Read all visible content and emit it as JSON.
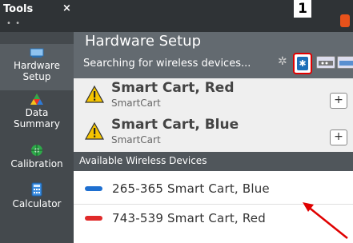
{
  "sidebar": {
    "title": "Tools",
    "close_label": "×",
    "grip": "• •",
    "items": [
      {
        "label_line1": "Hardware",
        "label_line2": "Setup",
        "icon": "hardware-icon"
      },
      {
        "label_line1": "Data",
        "label_line2": "Summary",
        "icon": "data-summary-icon"
      },
      {
        "label_line1": "Calibration",
        "label_line2": "",
        "icon": "calibration-icon"
      },
      {
        "label_line1": "Calculator",
        "label_line2": "",
        "icon": "calculator-icon"
      }
    ]
  },
  "hardware": {
    "title": "Hardware Setup",
    "status": "Searching for wireless devices...",
    "step_label": "1"
  },
  "devices": [
    {
      "name": "Smart Cart, Red",
      "type": "SmartCart",
      "add_label": "+"
    },
    {
      "name": "Smart Cart, Blue",
      "type": "SmartCart",
      "add_label": "+"
    }
  ],
  "available": {
    "header": "Available Wireless Devices",
    "items": [
      {
        "label": "265-365  Smart Cart, Blue",
        "color": "#1e6fd0"
      },
      {
        "label": "743-539  Smart Cart, Red",
        "color": "#e02a2a"
      }
    ]
  },
  "colors": {
    "accent_red": "#e00000",
    "bluetooth_blue": "#1d6fb8"
  }
}
